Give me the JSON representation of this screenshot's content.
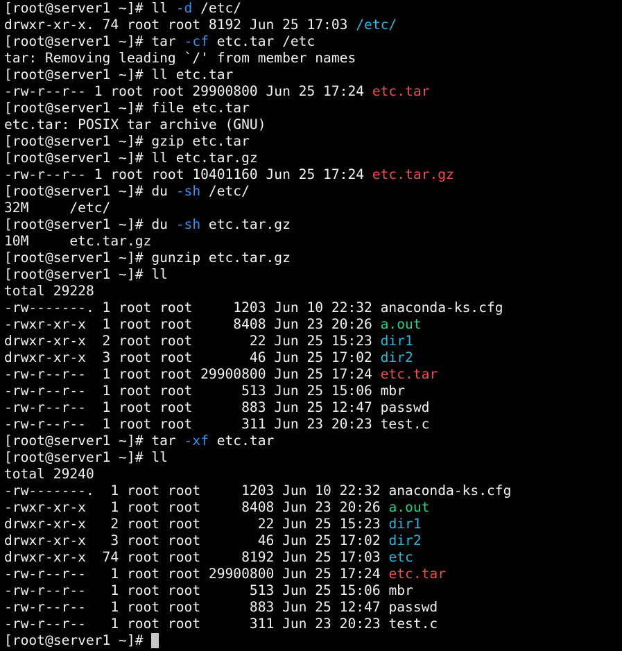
{
  "terminal": {
    "colors": {
      "background": "#000000",
      "default": "#f2f2f2",
      "option": "#3b8eea",
      "dir": "#29b8db",
      "exe": "#23d18b",
      "archive": "#f14c4c",
      "cursor": "#c8c8c8"
    },
    "lines": [
      {
        "kind": "command",
        "segments": [
          {
            "t": "[root@server1 ~]# ll ",
            "c": "default"
          },
          {
            "t": "-d",
            "c": "option"
          },
          {
            "t": " /etc/",
            "c": "default"
          }
        ]
      },
      {
        "kind": "output",
        "segments": [
          {
            "t": "drwxr-xr-x. 74 root root 8192 Jun 25 17:03 ",
            "c": "default"
          },
          {
            "t": "/etc/",
            "c": "dir"
          }
        ]
      },
      {
        "kind": "command",
        "segments": [
          {
            "t": "[root@server1 ~]# tar ",
            "c": "default"
          },
          {
            "t": "-cf",
            "c": "option"
          },
          {
            "t": " etc.tar /etc",
            "c": "default"
          }
        ]
      },
      {
        "kind": "output",
        "segments": [
          {
            "t": "tar: Removing leading `/' from member names",
            "c": "default"
          }
        ]
      },
      {
        "kind": "command",
        "segments": [
          {
            "t": "[root@server1 ~]# ll etc.tar",
            "c": "default"
          }
        ]
      },
      {
        "kind": "output",
        "segments": [
          {
            "t": "-rw-r--r-- 1 root root 29900800 Jun 25 17:24 ",
            "c": "default"
          },
          {
            "t": "etc.tar",
            "c": "archive"
          }
        ]
      },
      {
        "kind": "command",
        "segments": [
          {
            "t": "[root@server1 ~]# file etc.tar",
            "c": "default"
          }
        ]
      },
      {
        "kind": "output",
        "segments": [
          {
            "t": "etc.tar: POSIX tar archive (GNU)",
            "c": "default"
          }
        ]
      },
      {
        "kind": "command",
        "segments": [
          {
            "t": "[root@server1 ~]# gzip etc.tar",
            "c": "default"
          }
        ]
      },
      {
        "kind": "command",
        "segments": [
          {
            "t": "[root@server1 ~]# ll etc.tar.gz",
            "c": "default"
          }
        ]
      },
      {
        "kind": "output",
        "segments": [
          {
            "t": "-rw-r--r-- 1 root root 10401160 Jun 25 17:24 ",
            "c": "default"
          },
          {
            "t": "etc.tar.gz",
            "c": "archive"
          }
        ]
      },
      {
        "kind": "command",
        "segments": [
          {
            "t": "[root@server1 ~]# du ",
            "c": "default"
          },
          {
            "t": "-sh",
            "c": "option"
          },
          {
            "t": " /etc/",
            "c": "default"
          }
        ]
      },
      {
        "kind": "output",
        "segments": [
          {
            "t": "32M     /etc/",
            "c": "default"
          }
        ]
      },
      {
        "kind": "command",
        "segments": [
          {
            "t": "[root@server1 ~]# du ",
            "c": "default"
          },
          {
            "t": "-sh",
            "c": "option"
          },
          {
            "t": " etc.tar.gz",
            "c": "default"
          }
        ]
      },
      {
        "kind": "output",
        "segments": [
          {
            "t": "10M     etc.tar.gz",
            "c": "default"
          }
        ]
      },
      {
        "kind": "command",
        "segments": [
          {
            "t": "[root@server1 ~]# gunzip etc.tar.gz",
            "c": "default"
          }
        ]
      },
      {
        "kind": "command",
        "segments": [
          {
            "t": "[root@server1 ~]# ll",
            "c": "default"
          }
        ]
      },
      {
        "kind": "output",
        "segments": [
          {
            "t": "total 29228",
            "c": "default"
          }
        ]
      },
      {
        "kind": "listing",
        "segments": [
          {
            "t": "-rw-------. 1 root root     1203 Jun 10 22:32 ",
            "c": "default"
          },
          {
            "t": "anaconda-ks.cfg",
            "c": "default"
          }
        ]
      },
      {
        "kind": "listing",
        "segments": [
          {
            "t": "-rwxr-xr-x  1 root root     8408 Jun 23 20:26 ",
            "c": "default"
          },
          {
            "t": "a.out",
            "c": "exe"
          }
        ]
      },
      {
        "kind": "listing",
        "segments": [
          {
            "t": "drwxr-xr-x  2 root root       22 Jun 25 15:23 ",
            "c": "default"
          },
          {
            "t": "dir1",
            "c": "dir"
          }
        ]
      },
      {
        "kind": "listing",
        "segments": [
          {
            "t": "drwxr-xr-x  3 root root       46 Jun 25 17:02 ",
            "c": "default"
          },
          {
            "t": "dir2",
            "c": "dir"
          }
        ]
      },
      {
        "kind": "listing",
        "segments": [
          {
            "t": "-rw-r--r--  1 root root 29900800 Jun 25 17:24 ",
            "c": "default"
          },
          {
            "t": "etc.tar",
            "c": "archive"
          }
        ]
      },
      {
        "kind": "listing",
        "segments": [
          {
            "t": "-rw-r--r--  1 root root      513 Jun 25 15:06 ",
            "c": "default"
          },
          {
            "t": "mbr",
            "c": "default"
          }
        ]
      },
      {
        "kind": "listing",
        "segments": [
          {
            "t": "-rw-r--r--  1 root root      883 Jun 25 12:47 ",
            "c": "default"
          },
          {
            "t": "passwd",
            "c": "default"
          }
        ]
      },
      {
        "kind": "listing",
        "segments": [
          {
            "t": "-rw-r--r--  1 root root      311 Jun 23 20:23 ",
            "c": "default"
          },
          {
            "t": "test.c",
            "c": "default"
          }
        ]
      },
      {
        "kind": "command",
        "segments": [
          {
            "t": "[root@server1 ~]# tar ",
            "c": "default"
          },
          {
            "t": "-xf",
            "c": "option"
          },
          {
            "t": " etc.tar",
            "c": "default"
          }
        ]
      },
      {
        "kind": "command",
        "segments": [
          {
            "t": "[root@server1 ~]# ll",
            "c": "default"
          }
        ]
      },
      {
        "kind": "output",
        "segments": [
          {
            "t": "total 29240",
            "c": "default"
          }
        ]
      },
      {
        "kind": "listing",
        "segments": [
          {
            "t": "-rw-------.  1 root root     1203 Jun 10 22:32 ",
            "c": "default"
          },
          {
            "t": "anaconda-ks.cfg",
            "c": "default"
          }
        ]
      },
      {
        "kind": "listing",
        "segments": [
          {
            "t": "-rwxr-xr-x   1 root root     8408 Jun 23 20:26 ",
            "c": "default"
          },
          {
            "t": "a.out",
            "c": "exe"
          }
        ]
      },
      {
        "kind": "listing",
        "segments": [
          {
            "t": "drwxr-xr-x   2 root root       22 Jun 25 15:23 ",
            "c": "default"
          },
          {
            "t": "dir1",
            "c": "dir"
          }
        ]
      },
      {
        "kind": "listing",
        "segments": [
          {
            "t": "drwxr-xr-x   3 root root       46 Jun 25 17:02 ",
            "c": "default"
          },
          {
            "t": "dir2",
            "c": "dir"
          }
        ]
      },
      {
        "kind": "listing",
        "segments": [
          {
            "t": "drwxr-xr-x  74 root root     8192 Jun 25 17:03 ",
            "c": "default"
          },
          {
            "t": "etc",
            "c": "dir"
          }
        ]
      },
      {
        "kind": "listing",
        "segments": [
          {
            "t": "-rw-r--r--   1 root root 29900800 Jun 25 17:24 ",
            "c": "default"
          },
          {
            "t": "etc.tar",
            "c": "archive"
          }
        ]
      },
      {
        "kind": "listing",
        "segments": [
          {
            "t": "-rw-r--r--   1 root root      513 Jun 25 15:06 ",
            "c": "default"
          },
          {
            "t": "mbr",
            "c": "default"
          }
        ]
      },
      {
        "kind": "listing",
        "segments": [
          {
            "t": "-rw-r--r--   1 root root      883 Jun 25 12:47 ",
            "c": "default"
          },
          {
            "t": "passwd",
            "c": "default"
          }
        ]
      },
      {
        "kind": "listing",
        "segments": [
          {
            "t": "-rw-r--r--   1 root root      311 Jun 23 20:23 ",
            "c": "default"
          },
          {
            "t": "test.c",
            "c": "default"
          }
        ]
      }
    ],
    "prompt": "[root@server1 ~]# "
  }
}
